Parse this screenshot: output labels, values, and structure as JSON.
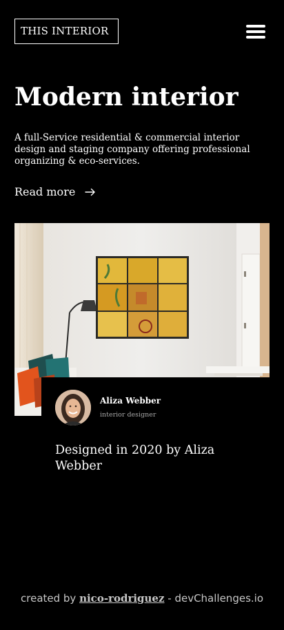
{
  "header": {
    "logo_text": "THIS INTERIOR",
    "menu_icon": "hamburger-menu-icon"
  },
  "hero": {
    "title": "Modern interior",
    "description": "A full-Service residential & commercial interior design and staging company offering professional organizing & eco-services.",
    "read_more_label": "Read more",
    "read_more_icon": "arrow-right-icon"
  },
  "author": {
    "name": "Aliza Webber",
    "role": "interior designer"
  },
  "designed_text": "Designed in 2020 by Aliza Webber",
  "footer": {
    "prefix": "created by ",
    "link_text": "nico-rodriguez",
    "suffix": " - devChallenges.io"
  },
  "colors": {
    "background": "#000000",
    "text": "#ffffff",
    "muted": "#a8a8a8"
  }
}
